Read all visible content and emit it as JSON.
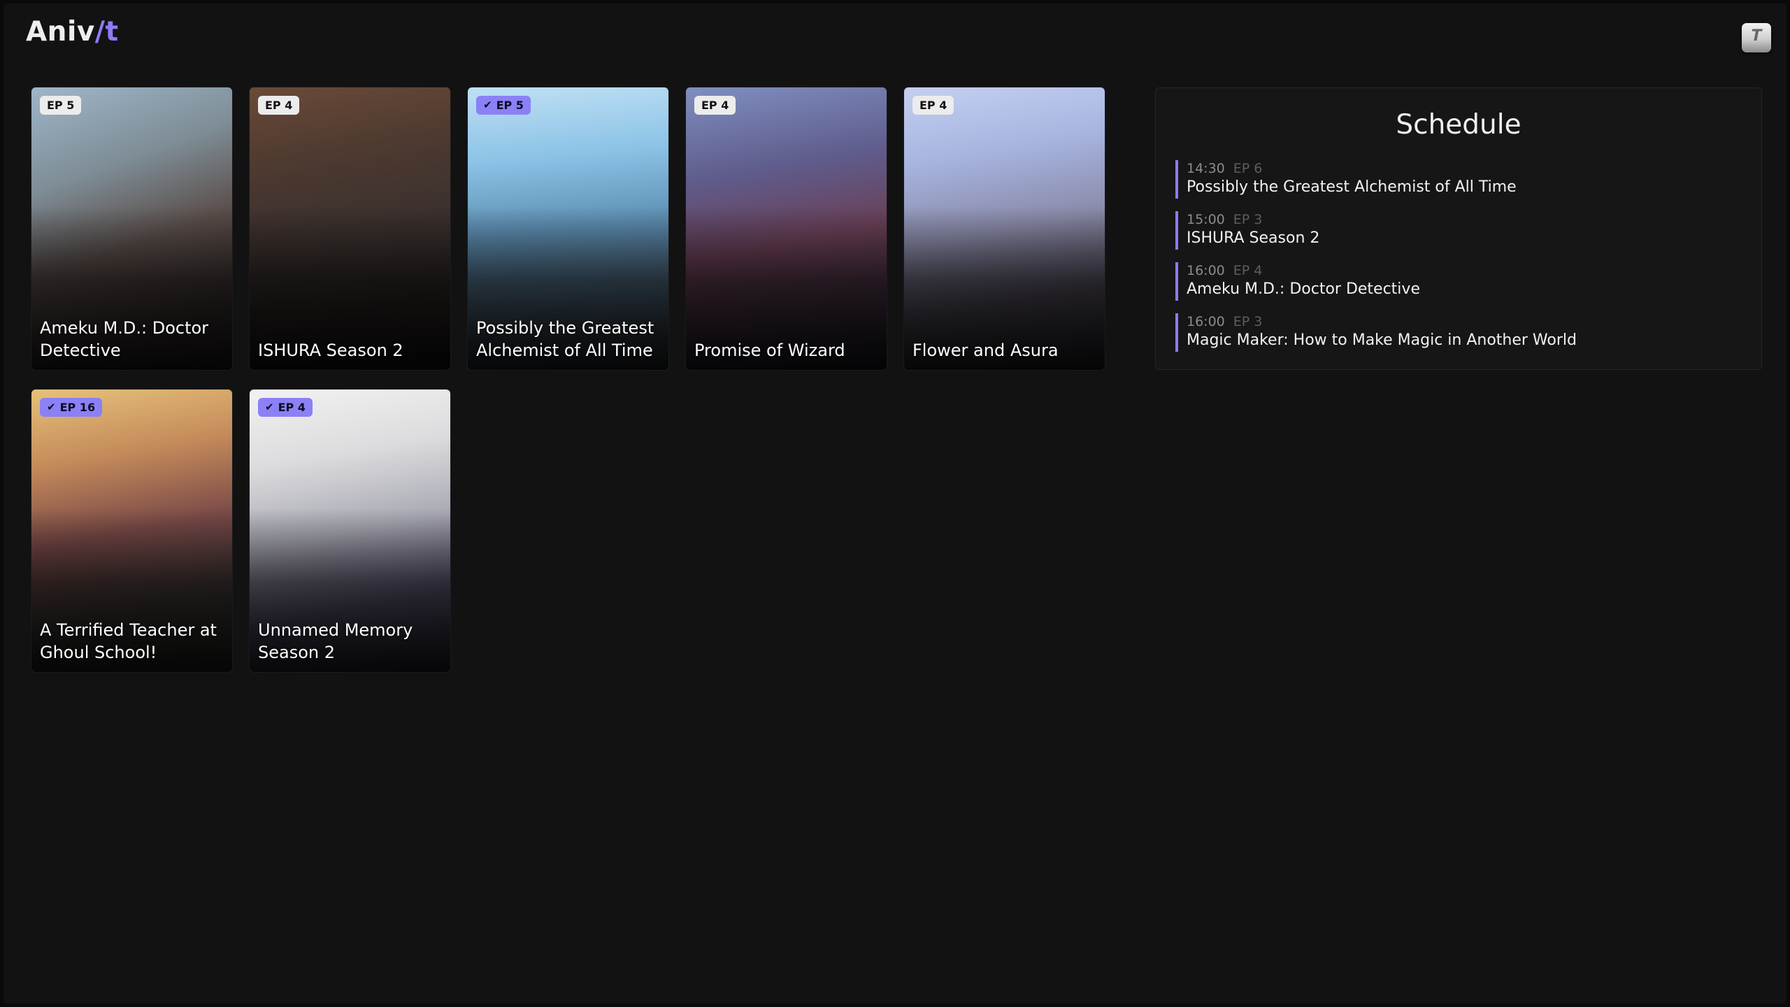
{
  "app": {
    "logo_prefix": "Aniv",
    "logo_accent": "/t",
    "user_button_label": "T"
  },
  "accent_color": "#8b7cf6",
  "cards": [
    {
      "title": "Ameku M.D.: Doctor Detective",
      "episode_badge": "EP 5",
      "watched": false
    },
    {
      "title": "ISHURA Season 2",
      "episode_badge": "EP 4",
      "watched": false
    },
    {
      "title": "Possibly the Greatest Alchemist of All Time",
      "episode_badge": "EP 5",
      "watched": true
    },
    {
      "title": "Promise of Wizard",
      "episode_badge": "EP 4",
      "watched": false
    },
    {
      "title": "Flower and Asura",
      "episode_badge": "EP 4",
      "watched": false
    },
    {
      "title": "A Terrified Teacher at Ghoul School!",
      "episode_badge": "EP 16",
      "watched": true
    },
    {
      "title": "Unnamed Memory Season 2",
      "episode_badge": "EP 4",
      "watched": true
    }
  ],
  "schedule": {
    "heading": "Schedule",
    "items": [
      {
        "time": "14:30",
        "episode": "EP 6",
        "title": "Possibly the Greatest Alchemist of All Time"
      },
      {
        "time": "15:00",
        "episode": "EP 3",
        "title": "ISHURA Season 2"
      },
      {
        "time": "16:00",
        "episode": "EP 4",
        "title": "Ameku M.D.: Doctor Detective"
      },
      {
        "time": "16:00",
        "episode": "EP 3",
        "title": "Magic Maker: How to Make Magic in Another World"
      }
    ]
  }
}
